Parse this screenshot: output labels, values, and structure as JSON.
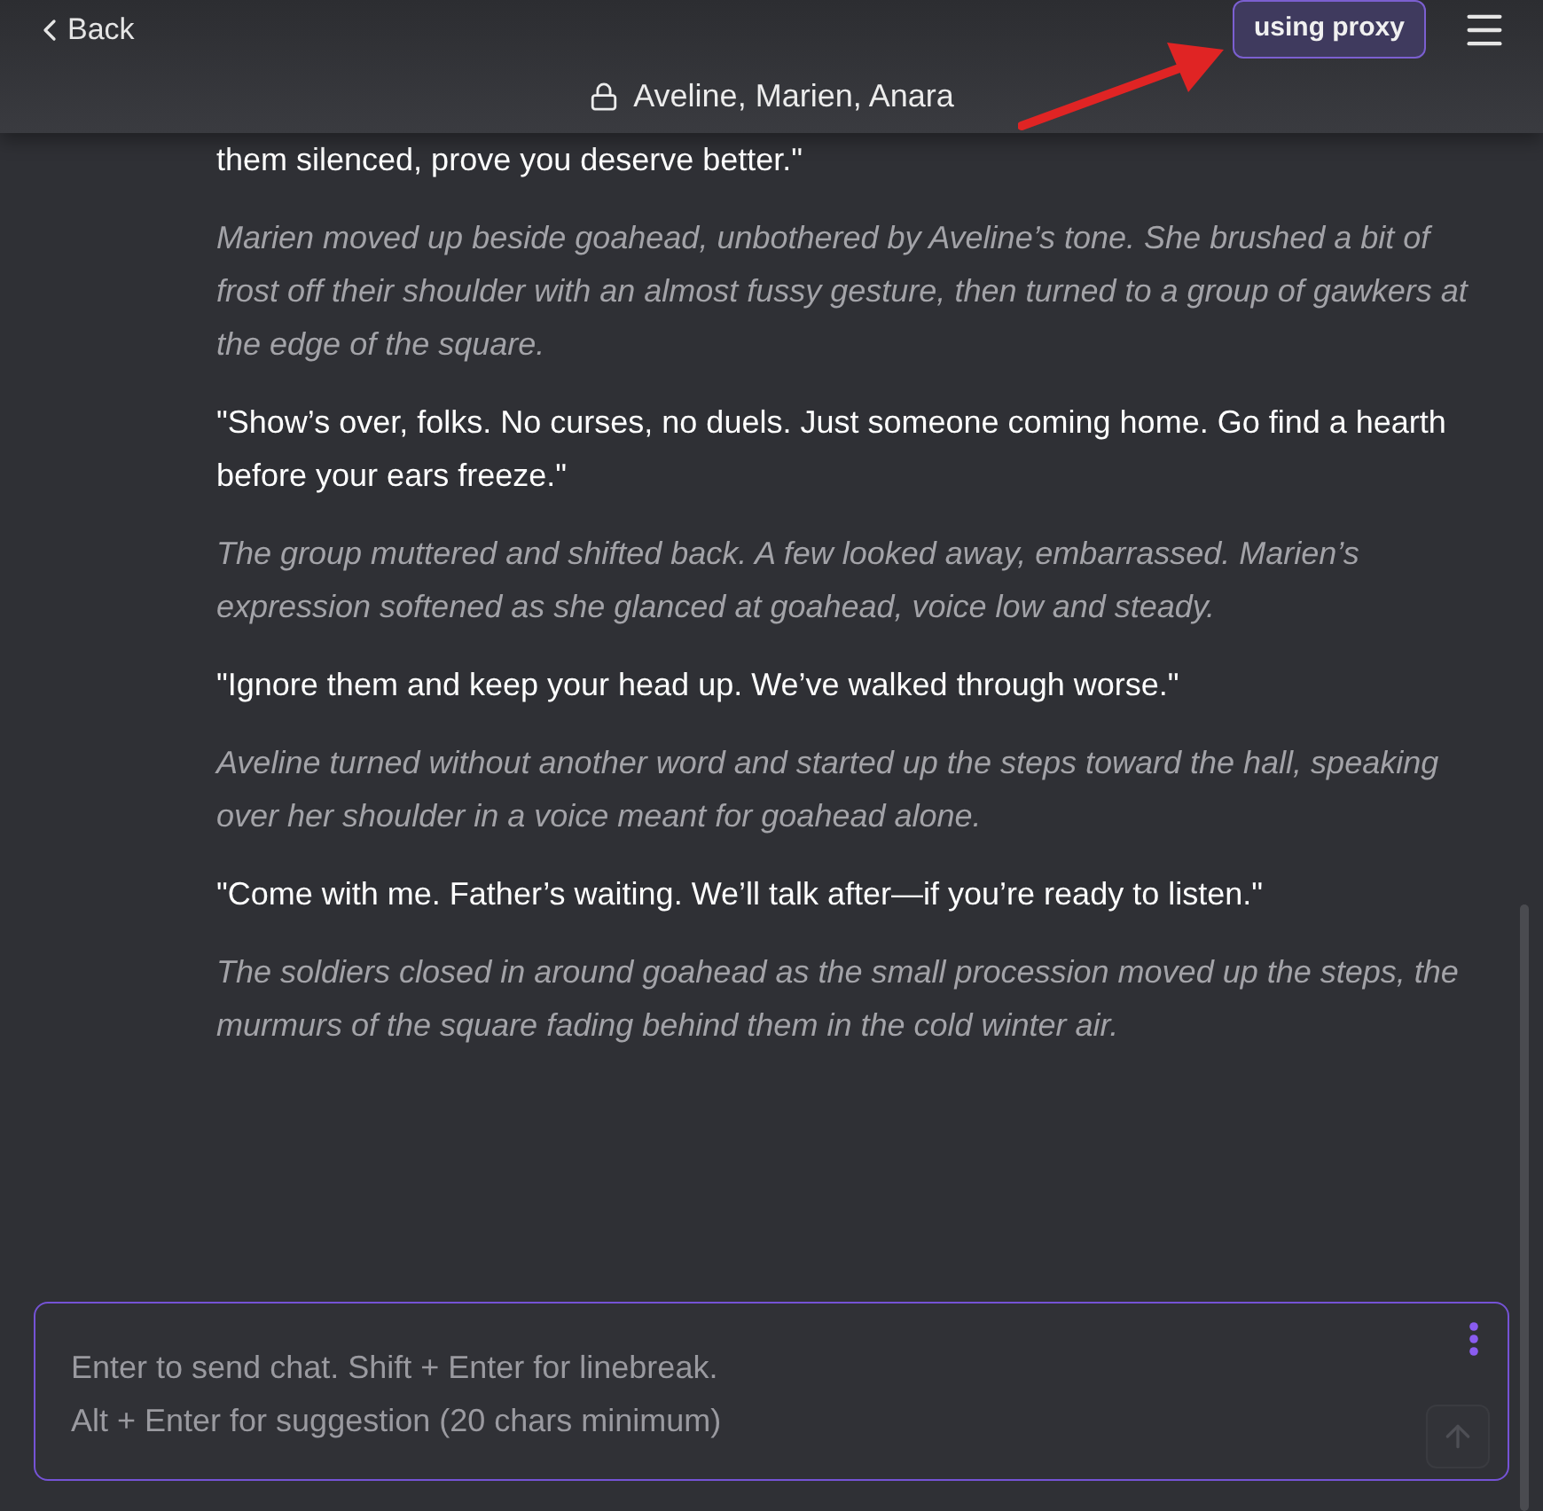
{
  "header": {
    "back_label": "Back",
    "title": "Aveline, Marien, Anara",
    "proxy_badge": "using proxy"
  },
  "messages": [
    {
      "kind": "dialogue",
      "text": "them silenced, prove you deserve better.\""
    },
    {
      "kind": "narration",
      "text": "Marien moved up beside goahead, unbothered by Aveline’s tone. She brushed a bit of frost off their shoulder with an almost fussy gesture, then turned to a group of gawkers at the edge of the square."
    },
    {
      "kind": "dialogue",
      "text": "\"Show’s over, folks. No curses, no duels. Just someone coming home. Go find a hearth before your ears freeze.\""
    },
    {
      "kind": "narration",
      "text": "The group muttered and shifted back. A few looked away, embarrassed. Marien’s expression softened as she glanced at goahead, voice low and steady."
    },
    {
      "kind": "dialogue",
      "text": "\"Ignore them and keep your head up. We’ve walked through worse.\""
    },
    {
      "kind": "narration",
      "text": "Aveline turned without another word and started up the steps toward the hall, speaking over her shoulder in a voice meant for goahead alone."
    },
    {
      "kind": "dialogue",
      "text": "\"Come with me. Father’s waiting. We’ll talk after—if you’re ready to listen.\""
    },
    {
      "kind": "narration",
      "text": "The soldiers closed in around goahead as the small procession moved up the steps, the murmurs of the square fading behind them in the cold winter air."
    }
  ],
  "composer": {
    "placeholder": "Enter to send chat. Shift + Enter for linebreak.\nAlt + Enter for suggestion (20 chars minimum)",
    "send_disabled": true
  }
}
